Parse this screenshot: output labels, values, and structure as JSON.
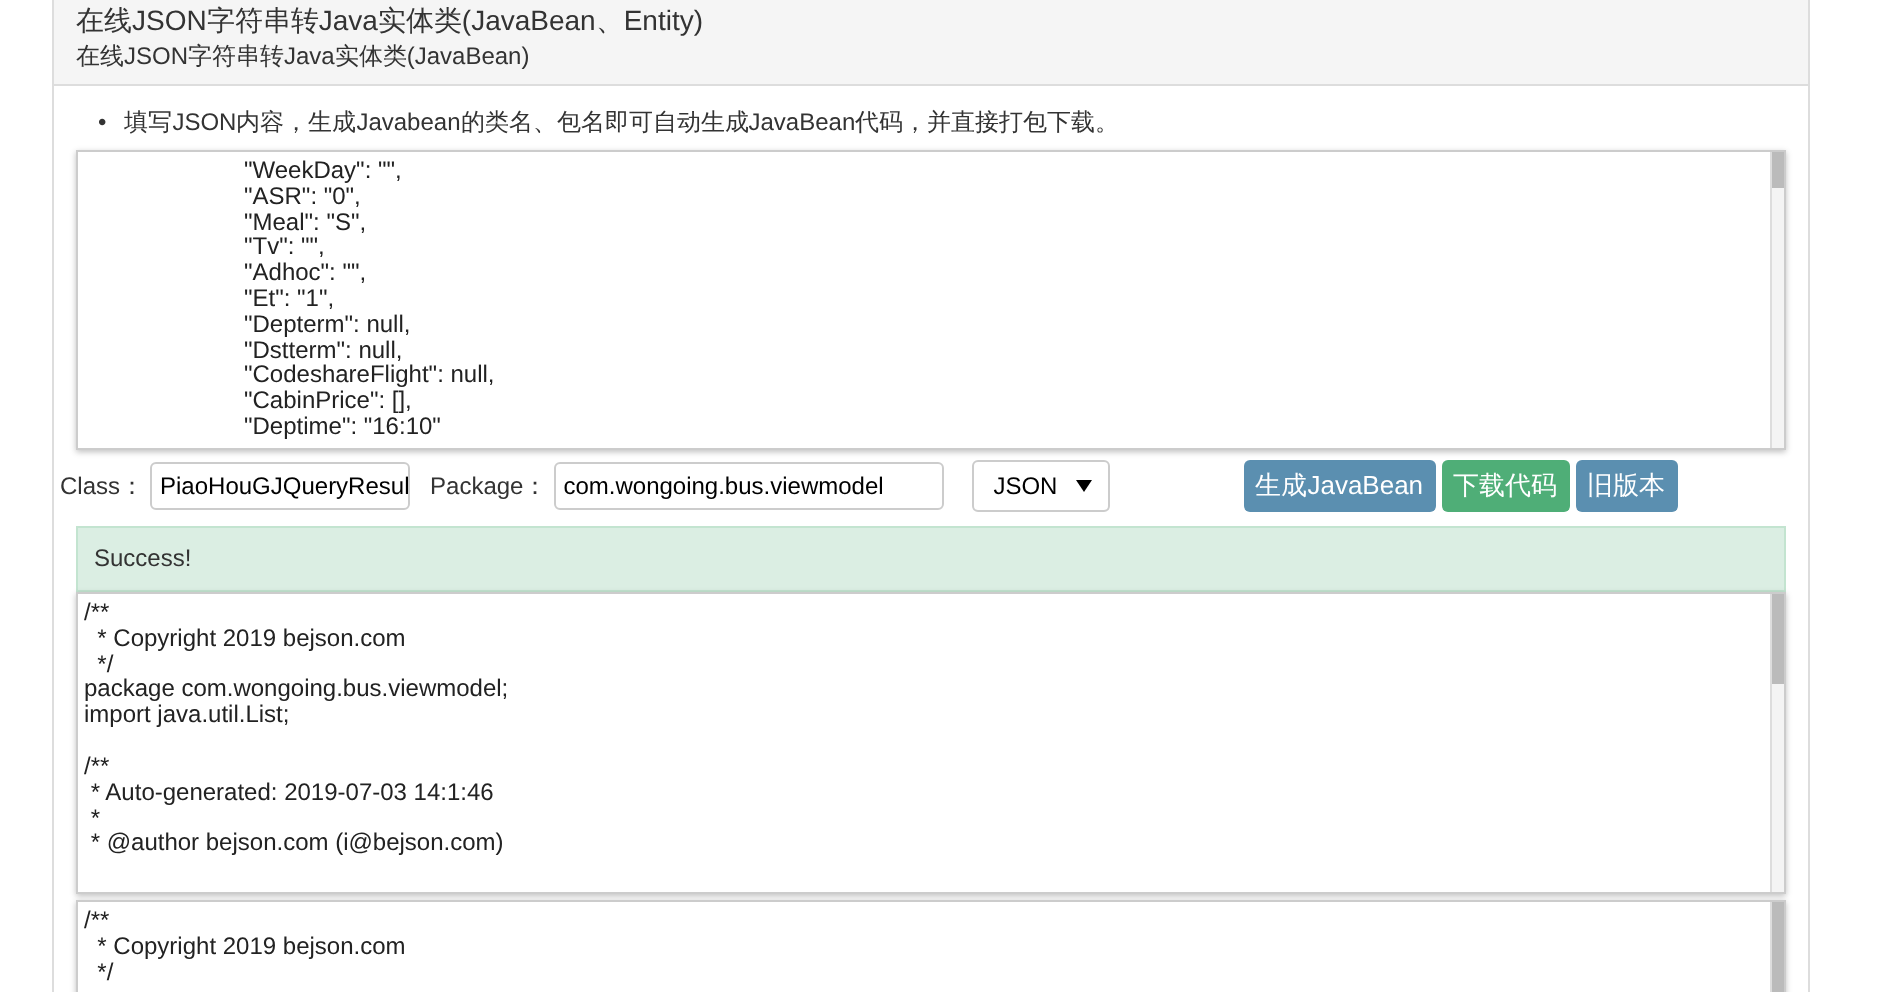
{
  "panel": {
    "title": "在线JSON字符串转Java实体类(JavaBean、Entity)",
    "subtitle": "在线JSON字符串转Java实体类(JavaBean)"
  },
  "notes": [
    {
      "marker": "•",
      "text": "填写JSON内容，生成Javabean的类名、包名即可自动生成JavaBean代码，并直接打包下载。"
    }
  ],
  "json_input": {
    "lines": [
      "\"WeekDay\": \"\",",
      "\"ASR\": \"0\",",
      "\"Meal\": \"S\",",
      "\"Tv\": \"\",",
      "\"Adhoc\": \"\",",
      "\"Et\": \"1\",",
      "\"Depterm\": null,",
      "\"Dstterm\": null,",
      "\"CodeshareFlight\": null,",
      "\"CabinPrice\": [],",
      "\"Deptime\": \"16:10\""
    ]
  },
  "form": {
    "class_label": "Class：",
    "class_value": "PiaoHouGJQueryResul",
    "package_label": "Package：",
    "package_value": "com.wongoing.bus.viewmodel",
    "format": "JSON",
    "buttons": [
      {
        "label": "生成JavaBean",
        "kind": "primary"
      },
      {
        "label": "下载代码",
        "kind": "success"
      },
      {
        "label": "旧版本",
        "kind": "primary"
      }
    ]
  },
  "status": {
    "message": "Success!"
  },
  "outputs": [
    {
      "blocks": [
        [
          "/**",
          "  * Copyright 2019 bejson.com",
          "  */",
          "package com.wongoing.bus.viewmodel;",
          "import java.util.List;"
        ],
        [
          "/**",
          " * Auto-generated: 2019-07-03 14:1:46",
          " *",
          " * @author bejson.com (i@bejson.com)"
        ]
      ]
    },
    {
      "blocks": [
        [
          "/**",
          "  * Copyright 2019 bejson.com",
          "  */"
        ]
      ]
    }
  ]
}
